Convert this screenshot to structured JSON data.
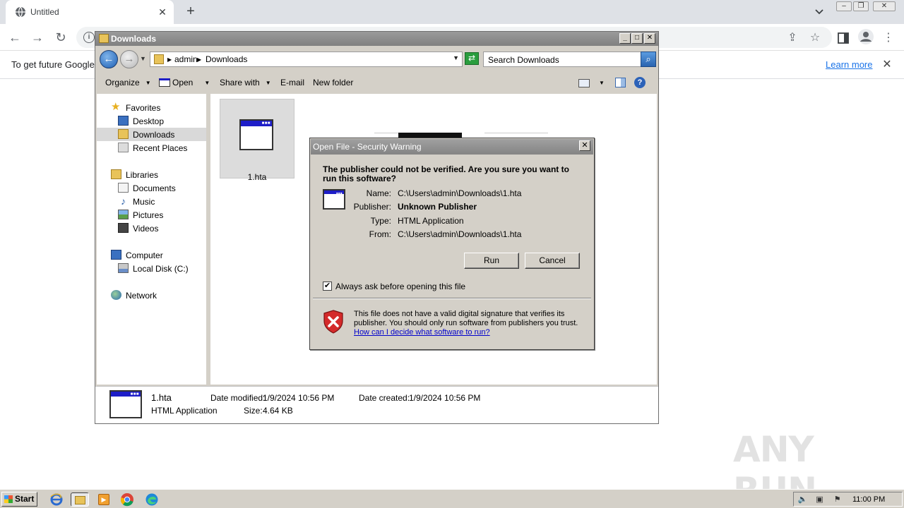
{
  "browser": {
    "tab_title": "Untitled",
    "infobar": {
      "message": "To get future Google",
      "learn_more": "Learn more"
    }
  },
  "explorer": {
    "title": "Downloads",
    "breadcrumb": [
      "admin",
      "Downloads"
    ],
    "search_placeholder": "Search Downloads",
    "commands": {
      "organize": "Organize",
      "open": "Open",
      "share_with": "Share with",
      "email": "E-mail",
      "new_folder": "New folder"
    },
    "nav": {
      "favorites": "Favorites",
      "desktop": "Desktop",
      "downloads": "Downloads",
      "recent_places": "Recent Places",
      "libraries": "Libraries",
      "documents": "Documents",
      "music": "Music",
      "pictures": "Pictures",
      "videos": "Videos",
      "computer": "Computer",
      "local_disk": "Local Disk (C:)",
      "network": "Network"
    },
    "file": {
      "name": "1.hta"
    },
    "details": {
      "name": "1.hta",
      "type": "HTML Application",
      "date_modified_label": "Date modified:",
      "date_modified": "1/9/2024 10:56 PM",
      "date_created_label": "Date created:",
      "date_created": "1/9/2024 10:56 PM",
      "size_label": "Size:",
      "size": "4.64 KB"
    }
  },
  "security_dialog": {
    "title": "Open File - Security Warning",
    "question": "The publisher could not be verified.  Are you sure you want to run this software?",
    "fields": {
      "name_label": "Name:",
      "name": "C:\\Users\\admin\\Downloads\\1.hta",
      "publisher_label": "Publisher:",
      "publisher": "Unknown Publisher",
      "type_label": "Type:",
      "type": "HTML Application",
      "from_label": "From:",
      "from": "C:\\Users\\admin\\Downloads\\1.hta"
    },
    "run_label": "Run",
    "cancel_label": "Cancel",
    "always_ask_label": "Always ask before opening this file",
    "always_ask_checked": true,
    "check_mark": "✔",
    "warning": "This file does not have a valid digital signature that verifies its publisher.  You should only run software from publishers you trust.",
    "help_link": "How can I decide what software to run?"
  },
  "watermark": "ANY RUN",
  "taskbar": {
    "start": "Start",
    "clock": "11:00 PM"
  },
  "colors": {
    "accent_blue": "#1a73e8",
    "title_gray": "#848484",
    "dialog_face": "#d4d0c8"
  }
}
